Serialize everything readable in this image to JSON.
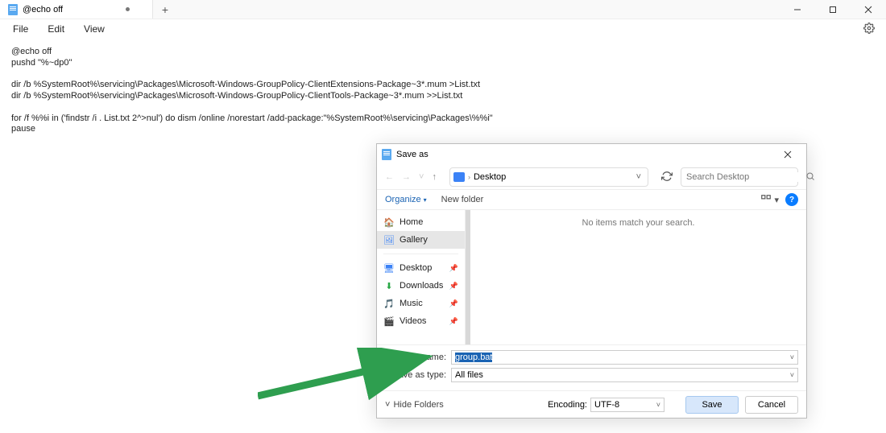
{
  "titlebar": {
    "tab_title": "@echo off",
    "modified": true
  },
  "menubar": {
    "file": "File",
    "edit": "Edit",
    "view": "View"
  },
  "document": "@echo off\npushd \"%~dp0\"\n\ndir /b %SystemRoot%\\servicing\\Packages\\Microsoft-Windows-GroupPolicy-ClientExtensions-Package~3*.mum >List.txt\ndir /b %SystemRoot%\\servicing\\Packages\\Microsoft-Windows-GroupPolicy-ClientTools-Package~3*.mum >>List.txt\n\nfor /f %%i in ('findstr /i . List.txt 2^>nul') do dism /online /norestart /add-package:\"%SystemRoot%\\servicing\\Packages\\%%i\"\npause",
  "dialog": {
    "title": "Save as",
    "path_label": "Desktop",
    "search_placeholder": "Search Desktop",
    "organize": "Organize",
    "new_folder": "New folder",
    "sidebar": {
      "home": "Home",
      "gallery": "Gallery",
      "desktop": "Desktop",
      "downloads": "Downloads",
      "music": "Music",
      "videos": "Videos"
    },
    "empty": "No items match your search.",
    "file_name_label": "File name:",
    "file_name_value": "group.bat",
    "save_type_label": "Save as type:",
    "save_type_value": "All files",
    "hide_folders": "Hide Folders",
    "encoding_label": "Encoding:",
    "encoding_value": "UTF-8",
    "save": "Save",
    "cancel": "Cancel"
  }
}
